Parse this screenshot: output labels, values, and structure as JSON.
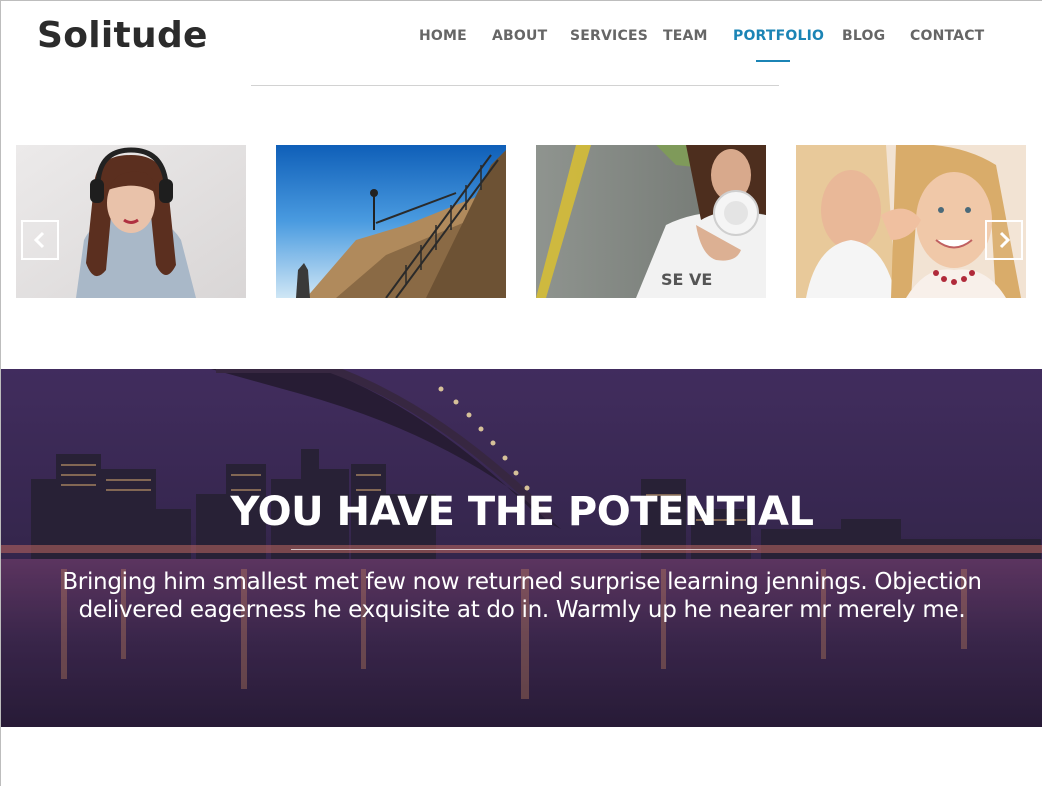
{
  "site": {
    "logo": "Solitude"
  },
  "nav": {
    "items": [
      {
        "label": "HOME"
      },
      {
        "label": "ABOUT"
      },
      {
        "label": "SERVICES"
      },
      {
        "label": "TEAM"
      },
      {
        "label": "PORTFOLIO",
        "active": true
      },
      {
        "label": "BLOG"
      },
      {
        "label": "CONTACT"
      }
    ],
    "active_color": "#1b84b5"
  },
  "portfolio": {
    "items": [
      {
        "subject": "woman-with-headphones"
      },
      {
        "subject": "bridge-staircase-sky"
      },
      {
        "subject": "girl-holding-headphones-road"
      },
      {
        "subject": "two-girls-whispering"
      }
    ],
    "prev_icon": "chevron-left-icon",
    "next_icon": "chevron-right-icon"
  },
  "banner": {
    "title": "YOU HAVE THE POTENTIAL",
    "text": "Bringing him smallest met few now returned surprise learning jennings. Objection delivered eagerness he exquisite at do in. Warmly up he nearer mr merely me.",
    "image": "city-skyline-bridge-night"
  }
}
